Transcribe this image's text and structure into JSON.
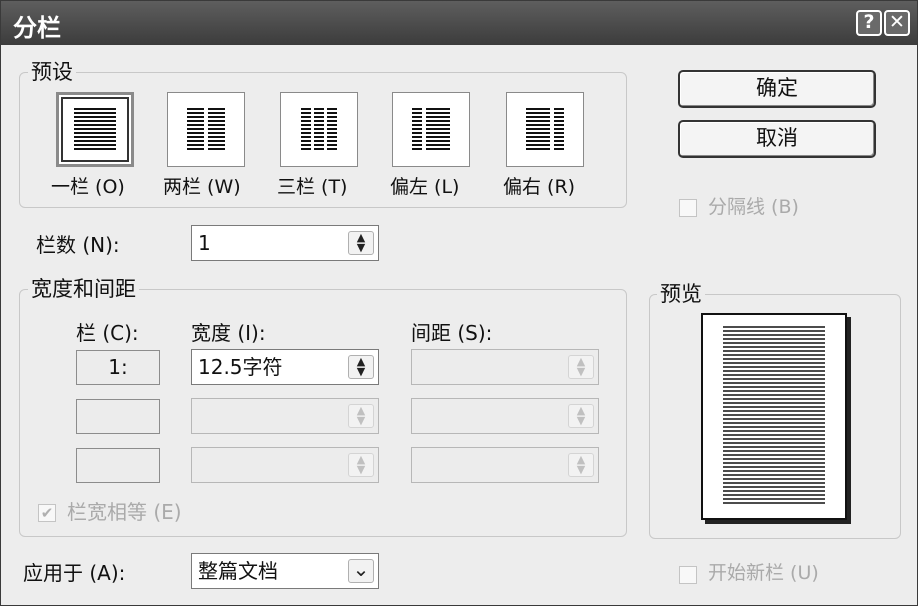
{
  "window": {
    "title": "分栏",
    "help_btn": "?",
    "close_btn": "✕"
  },
  "presets": {
    "group_label": "预设",
    "items": [
      {
        "label": "一栏 (O)",
        "icon": "one-column-icon",
        "selected": true
      },
      {
        "label": "两栏 (W)",
        "icon": "two-columns-icon",
        "selected": false
      },
      {
        "label": "三栏 (T)",
        "icon": "three-columns-icon",
        "selected": false
      },
      {
        "label": "偏左 (L)",
        "icon": "left-column-icon",
        "selected": false
      },
      {
        "label": "偏右 (R)",
        "icon": "right-column-icon",
        "selected": false
      }
    ]
  },
  "buttons": {
    "ok": "确定",
    "cancel": "取消"
  },
  "separator": {
    "label": "分隔线 (B)",
    "checked": false,
    "enabled": false
  },
  "column_count": {
    "label": "栏数 (N):",
    "value": "1"
  },
  "width_spacing": {
    "group_label": "宽度和间距",
    "col_header": "栏 (C):",
    "width_header": "宽度 (I):",
    "spacing_header": "间距 (S):",
    "rows": [
      {
        "col": "1:",
        "width": "12.5字符",
        "spacing": ""
      },
      {
        "col": "",
        "width": "",
        "spacing": ""
      },
      {
        "col": "",
        "width": "",
        "spacing": ""
      }
    ],
    "equal_width": {
      "label": "栏宽相等 (E)",
      "checked": true,
      "enabled": false
    }
  },
  "preview": {
    "label": "预览"
  },
  "apply_to": {
    "label": "应用于 (A):",
    "value": "整篇文档"
  },
  "new_column": {
    "label": "开始新栏 (U)",
    "checked": false,
    "enabled": false
  },
  "spin_up": "▲",
  "spin_down": "▼",
  "dropdown_arrow": "⌄",
  "check_mark": "✔"
}
